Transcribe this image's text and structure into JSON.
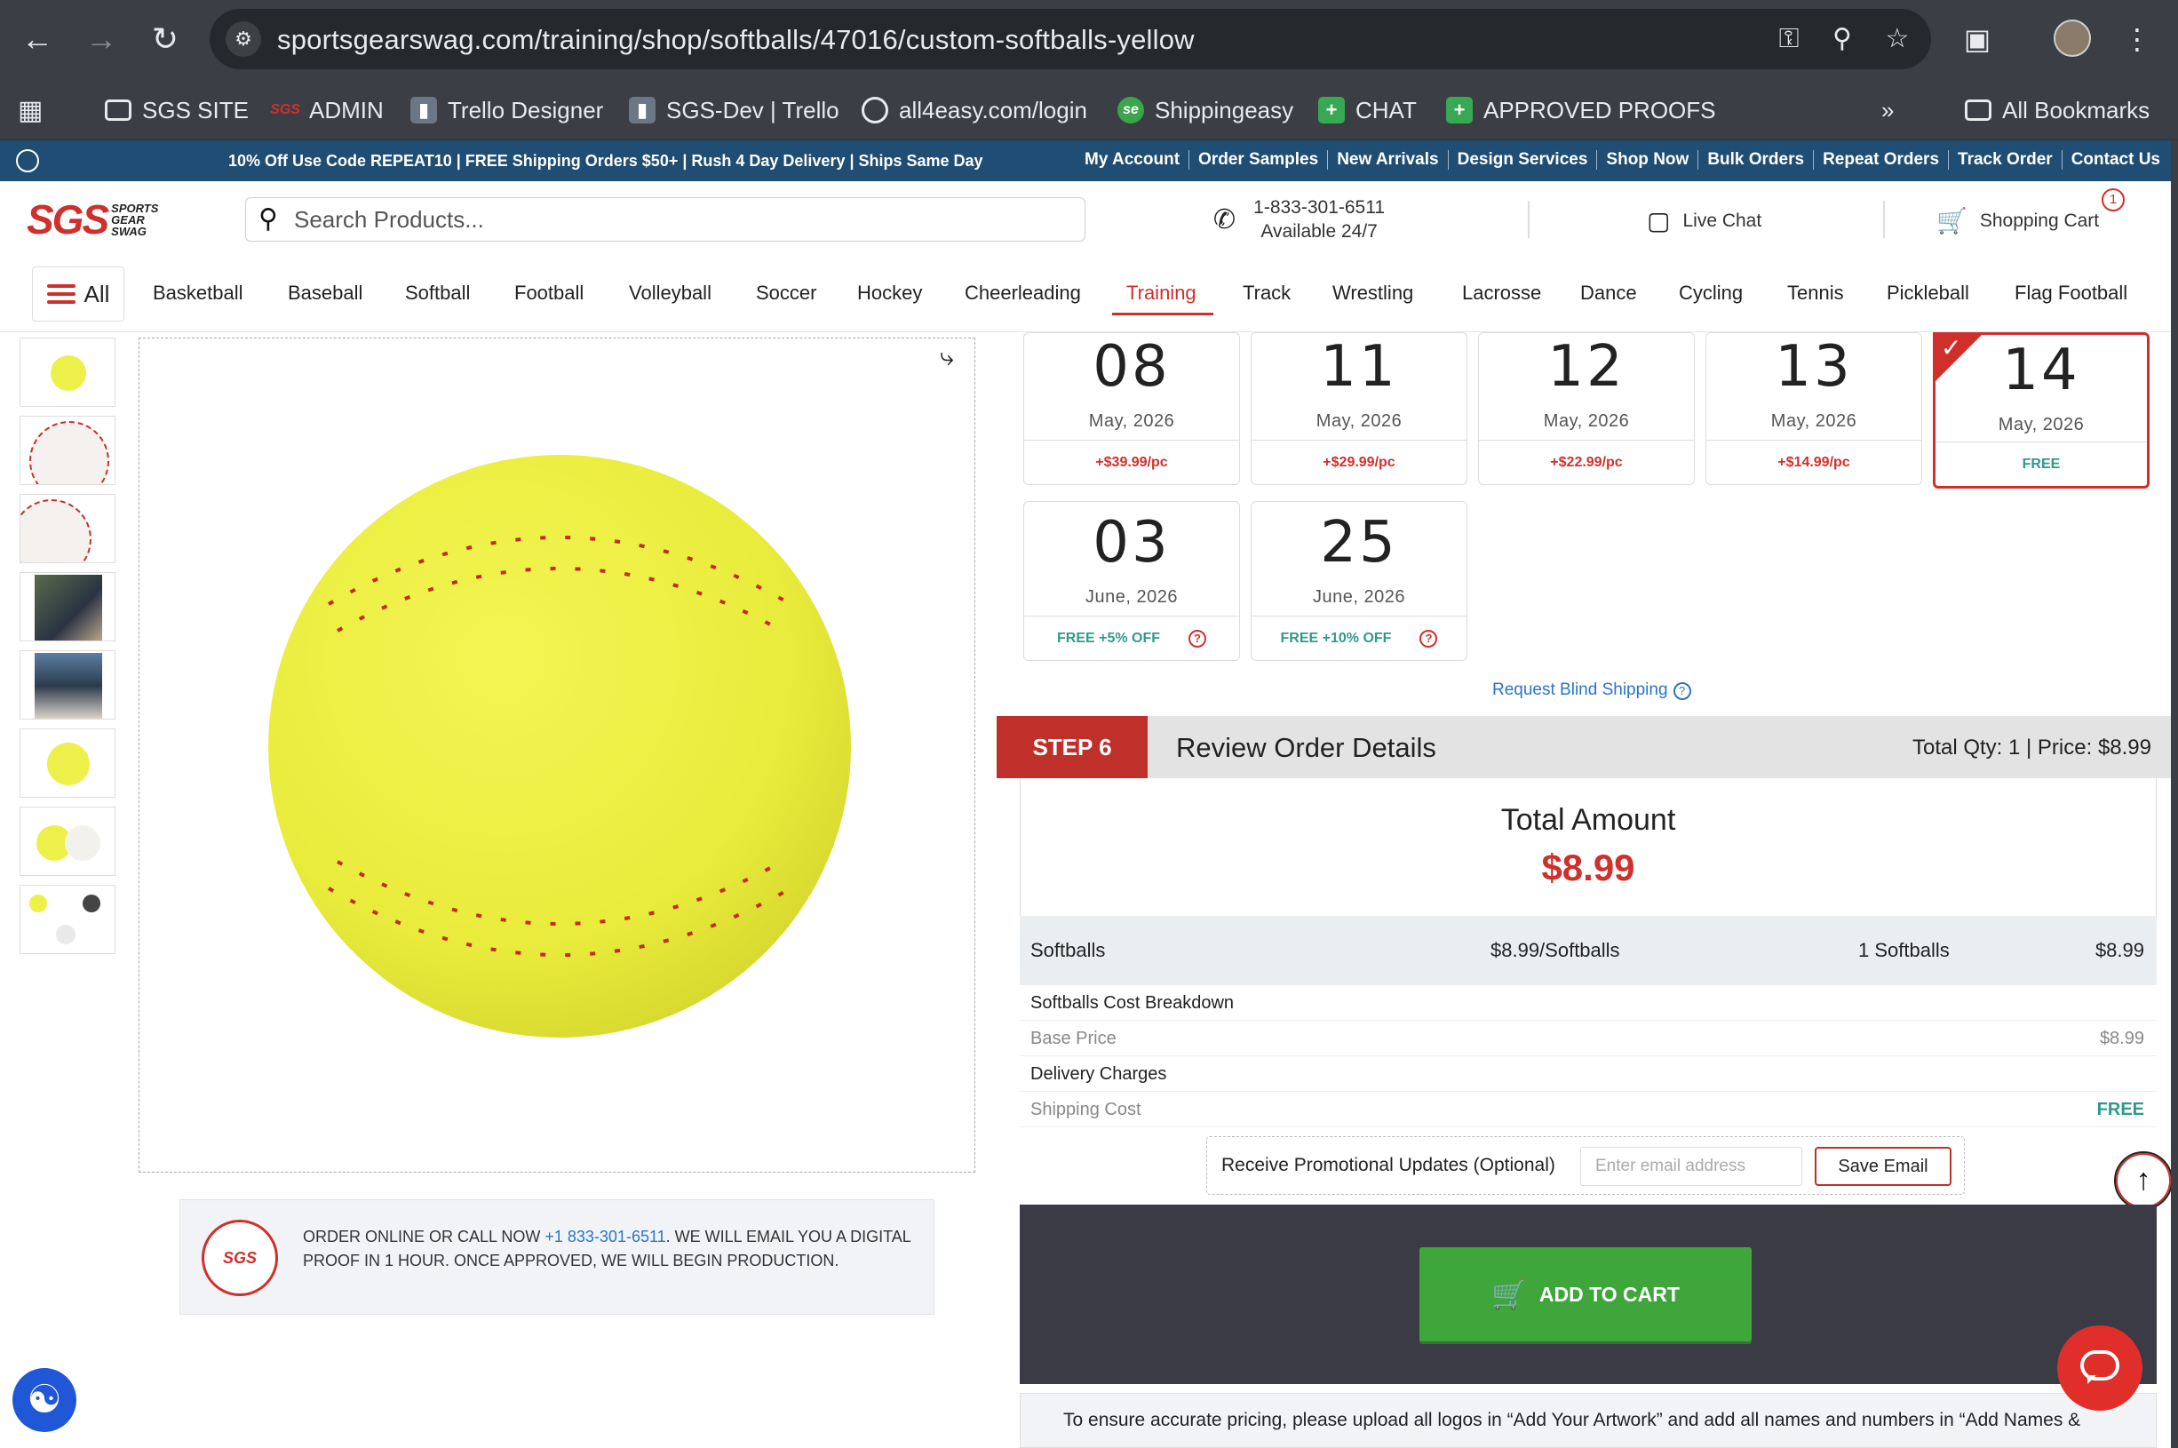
{
  "browser": {
    "url": "sportsgearswag.com/training/shop/softballs/47016/custom-softballs-yellow",
    "bookmarks": [
      {
        "label": "SGS SITE",
        "icon": "folder-icon"
      },
      {
        "label": "ADMIN",
        "icon": "sgs-icon"
      },
      {
        "label": "Trello Designer",
        "icon": "trello-icon"
      },
      {
        "label": "SGS-Dev | Trello",
        "icon": "trello-icon"
      },
      {
        "label": "all4easy.com/login",
        "icon": "globe-icon"
      },
      {
        "label": "Shippingeasy",
        "icon": "shippingeasy-icon"
      },
      {
        "label": "CHAT",
        "icon": "plus-icon"
      },
      {
        "label": "APPROVED PROOFS",
        "icon": "plus-icon"
      }
    ],
    "all_bookmarks": "All Bookmarks"
  },
  "promo": {
    "text": "10% Off Use Code REPEAT10 | FREE Shipping Orders $50+ | Rush 4 Day Delivery | Ships Same Day",
    "links": [
      "My Account",
      "Order Samples",
      "New Arrivals",
      "Design Services",
      "Shop Now",
      "Bulk Orders",
      "Repeat Orders",
      "Track Order",
      "Contact Us"
    ]
  },
  "header": {
    "logo_main": "SGS",
    "logo_sub": [
      "SPORTS",
      "GEAR",
      "SWAG"
    ],
    "search_placeholder": "Search Products...",
    "phone": "1-833-301-6511",
    "availability": "Available 24/7",
    "live_chat": "Live Chat",
    "cart_label": "Shopping Cart",
    "cart_count": "1"
  },
  "nav": {
    "all": "All",
    "categories": [
      "Basketball",
      "Baseball",
      "Softball",
      "Football",
      "Volleyball",
      "Soccer",
      "Hockey",
      "Cheerleading",
      "Training",
      "Track",
      "Wrestling",
      "Lacrosse",
      "Dance",
      "Cycling",
      "Tennis",
      "Pickleball",
      "Flag Football"
    ],
    "active": "Training"
  },
  "info_box": {
    "seal_text": "SGS",
    "text_before": "ORDER ONLINE OR CALL NOW ",
    "phone_link": "+1 833-301-6511",
    "text_after": ". WE WILL EMAIL YOU A DIGITAL PROOF IN 1 HOUR. ONCE APPROVED, WE WILL BEGIN PRODUCTION."
  },
  "delivery_dates": [
    {
      "day": "08",
      "month": "May, 2026",
      "price": "+$39.99/pc",
      "selected": false
    },
    {
      "day": "11",
      "month": "May, 2026",
      "price": "+$29.99/pc",
      "selected": false
    },
    {
      "day": "12",
      "month": "May, 2026",
      "price": "+$22.99/pc",
      "selected": false
    },
    {
      "day": "13",
      "month": "May, 2026",
      "price": "+$14.99/pc",
      "selected": false
    },
    {
      "day": "14",
      "month": "May, 2026",
      "price": "FREE",
      "selected": true
    },
    {
      "day": "03",
      "month": "June, 2026",
      "price": "FREE +5% OFF",
      "selected": false
    },
    {
      "day": "25",
      "month": "June, 2026",
      "price": "FREE +10% OFF",
      "selected": false
    }
  ],
  "blind_shipping": "Request Blind Shipping",
  "step6": {
    "tag": "STEP 6",
    "title": "Review Order Details",
    "summary": "Total Qty: 1 | Price: $8.99"
  },
  "total": {
    "label": "Total Amount",
    "amount": "$8.99"
  },
  "line_item": {
    "name": "Softballs",
    "unit_price": "$8.99/Softballs",
    "qty": "1 Softballs",
    "price": "$8.99"
  },
  "breakdown": {
    "cost_heading": "Softballs Cost Breakdown",
    "base_label": "Base Price",
    "base_value": "$8.99",
    "delivery_heading": "Delivery Charges",
    "shipping_label": "Shipping Cost",
    "shipping_value": "FREE"
  },
  "email": {
    "label": "Receive Promotional Updates (Optional)",
    "placeholder": "Enter email address",
    "button": "Save Email"
  },
  "add_to_cart": "ADD TO CART",
  "bottom_note": "To ensure accurate pricing, please upload all logos in “Add Your Artwork” and add all names and numbers in “Add Names &"
}
